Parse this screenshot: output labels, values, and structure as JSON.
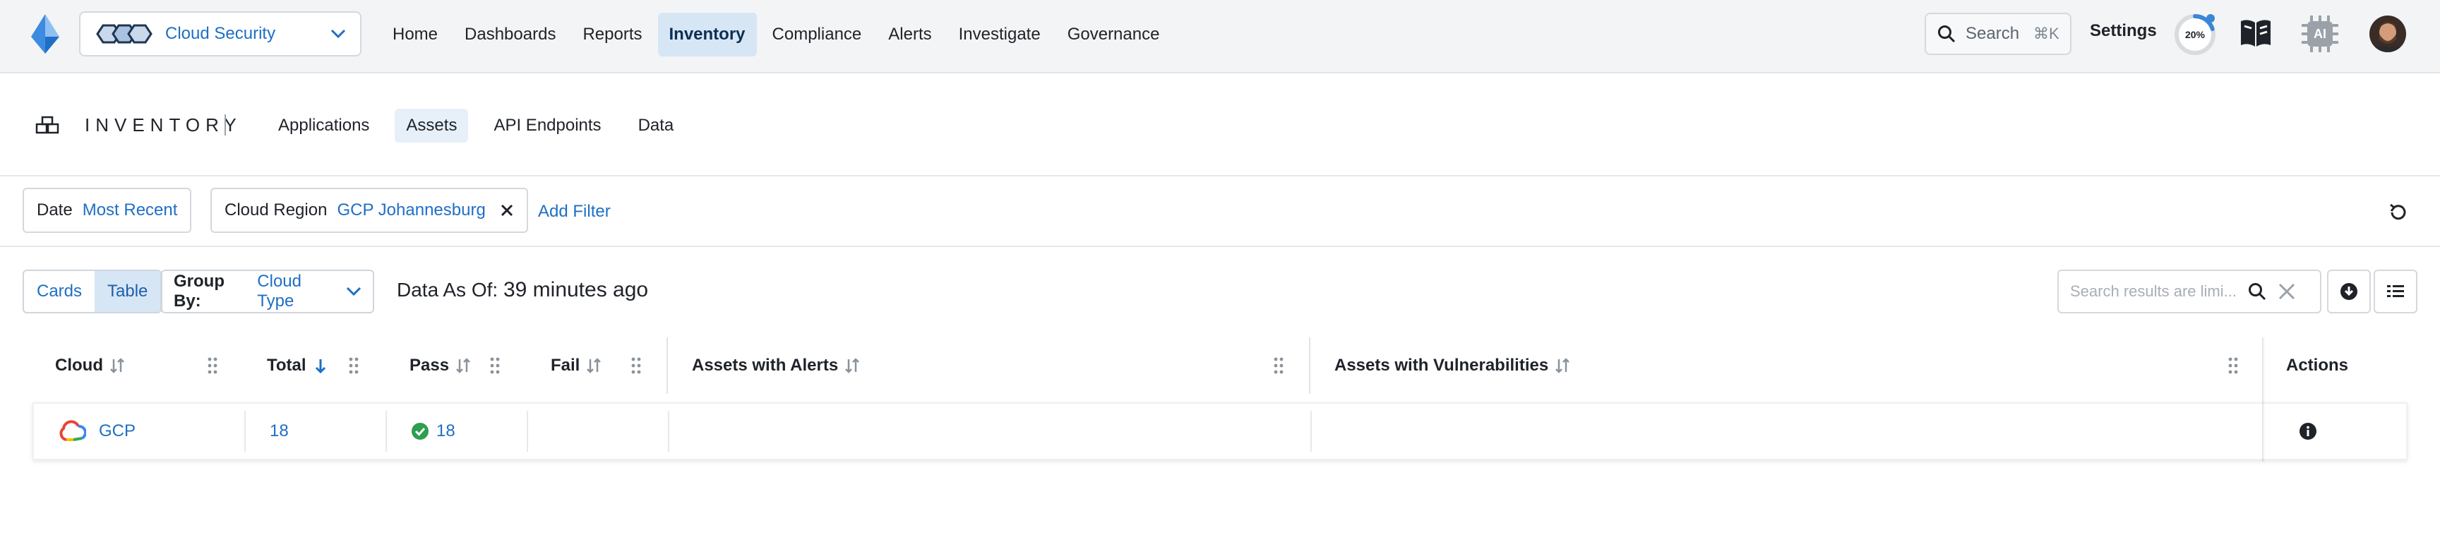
{
  "colors": {
    "accent": "#1f6fc5",
    "active_bg": "#d6e6f5",
    "pass_green": "#2e9e4f"
  },
  "product_select": {
    "label": "Cloud Security",
    "icon": "product-hexagons-icon"
  },
  "nav": {
    "items": [
      {
        "label": "Home",
        "active": false
      },
      {
        "label": "Dashboards",
        "active": false
      },
      {
        "label": "Reports",
        "active": false
      },
      {
        "label": "Inventory",
        "active": true
      },
      {
        "label": "Compliance",
        "active": false
      },
      {
        "label": "Alerts",
        "active": false
      },
      {
        "label": "Investigate",
        "active": false
      },
      {
        "label": "Governance",
        "active": false
      }
    ]
  },
  "topbar": {
    "search_label": "Search",
    "search_shortcut": "⌘K",
    "settings_label": "Settings",
    "progress_text": "20%",
    "progress_value": 0.2,
    "ai_label": "AI"
  },
  "inventory": {
    "title": "INVENTORY",
    "tabs": [
      {
        "label": "Applications",
        "active": false
      },
      {
        "label": "Assets",
        "active": true
      },
      {
        "label": "API Endpoints",
        "active": false
      },
      {
        "label": "Data",
        "active": false
      }
    ]
  },
  "filters": {
    "date": {
      "key": "Date",
      "value": "Most Recent"
    },
    "region": {
      "key": "Cloud Region",
      "value": "GCP Johannesburg"
    },
    "add_label": "Add Filter"
  },
  "toolbar": {
    "view_cards": "Cards",
    "view_table": "Table",
    "groupby_key": "Group By:",
    "groupby_value": "Cloud Type",
    "data_as_of_label": "Data As Of:",
    "data_as_of_value": "39 minutes ago",
    "search_placeholder": "Search results are limi..."
  },
  "table": {
    "headers": {
      "cloud": "Cloud",
      "total": "Total",
      "pass": "Pass",
      "fail": "Fail",
      "alerts": "Assets with Alerts",
      "vulns": "Assets with Vulnerabilities",
      "actions": "Actions"
    },
    "rows": [
      {
        "cloud": "GCP",
        "total": "18",
        "pass": "18",
        "fail": "",
        "alerts": "",
        "vulns": ""
      }
    ]
  }
}
